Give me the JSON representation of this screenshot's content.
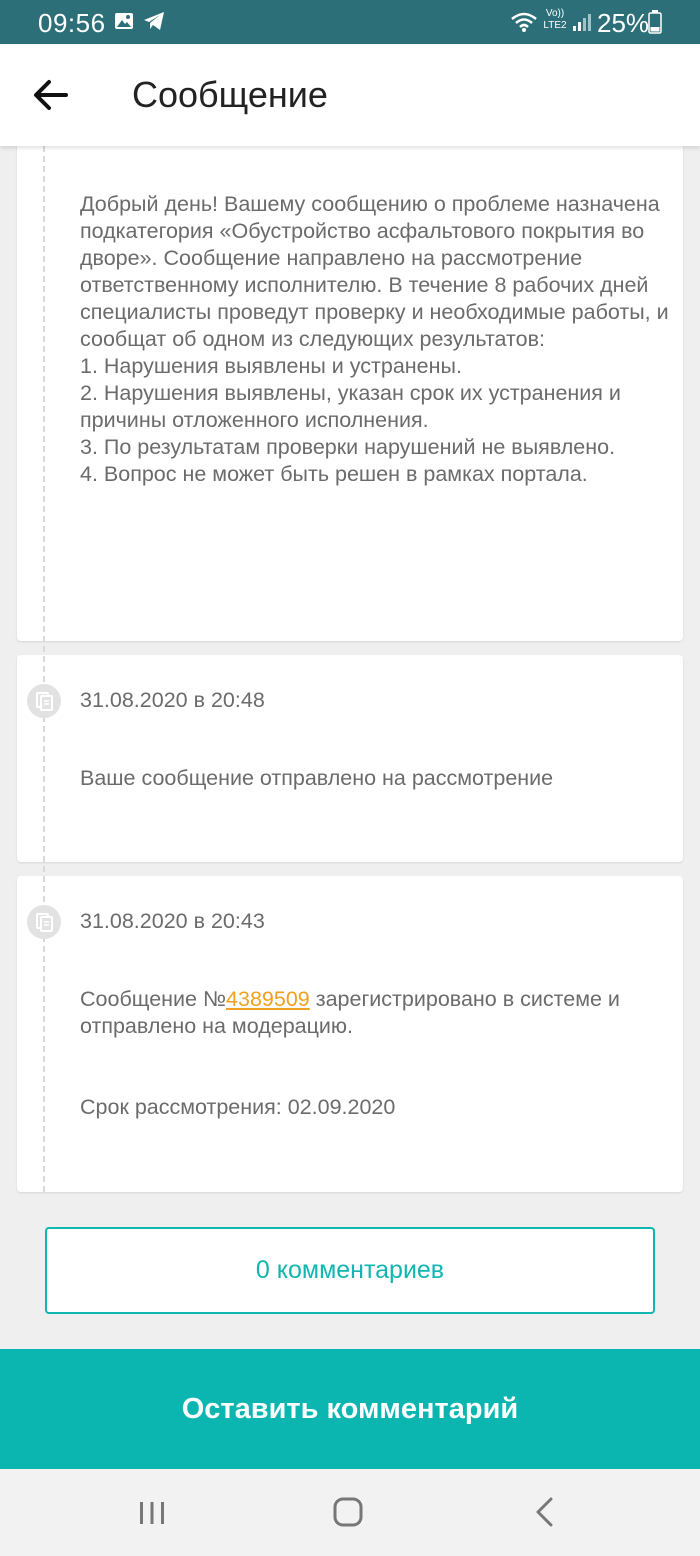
{
  "status_bar": {
    "time": "09:56",
    "network_label": "Vo)) LTE2",
    "battery": "25%",
    "icons": [
      "image-icon",
      "telegram-icon",
      "wifi-icon",
      "lte-icon",
      "signal-icon",
      "battery-icon"
    ]
  },
  "header": {
    "title": "Сообщение",
    "back_icon": "arrow-left-icon"
  },
  "events": [
    {
      "text": "Добрый день! Вашему сообщению о проблеме назначена подкатегория «Обустройство асфальтового покрытия во дворе». Сообщение направлено на рассмотрение ответственному исполнителю. В течение 8 рабочих дней специалисты проведут проверку и необходимые работы, и сообщат об одном из следующих результатов:\n1. Нарушения выявлены и устранены.\n2. Нарушения выявлены, указан срок их устранения и причины отложенного исполнения.\n3. По результатам проверки нарушений не выявлено.\n4. Вопрос не может быть решен в рамках портала."
    },
    {
      "date": "31.08.2020 в 20:48",
      "text": "Ваше сообщение отправлено на рассмотрение"
    },
    {
      "date": "31.08.2020 в 20:43",
      "text_prefix": "Сообщение №",
      "link": "4389509",
      "text_suffix": " зарегистрировано в системе и отправлено на модерацию.",
      "deadline": "Срок рассмотрения: 02.09.2020"
    }
  ],
  "comments_button": "0 комментариев",
  "leave_comment_button": "Оставить комментарий",
  "colors": {
    "status_bar": "#2d6f78",
    "accent": "#10b6b0",
    "link": "#f0a020",
    "text": "#6b6b6b"
  },
  "nav_bar": {
    "icons": [
      "recents-icon",
      "home-icon",
      "back-icon"
    ]
  }
}
